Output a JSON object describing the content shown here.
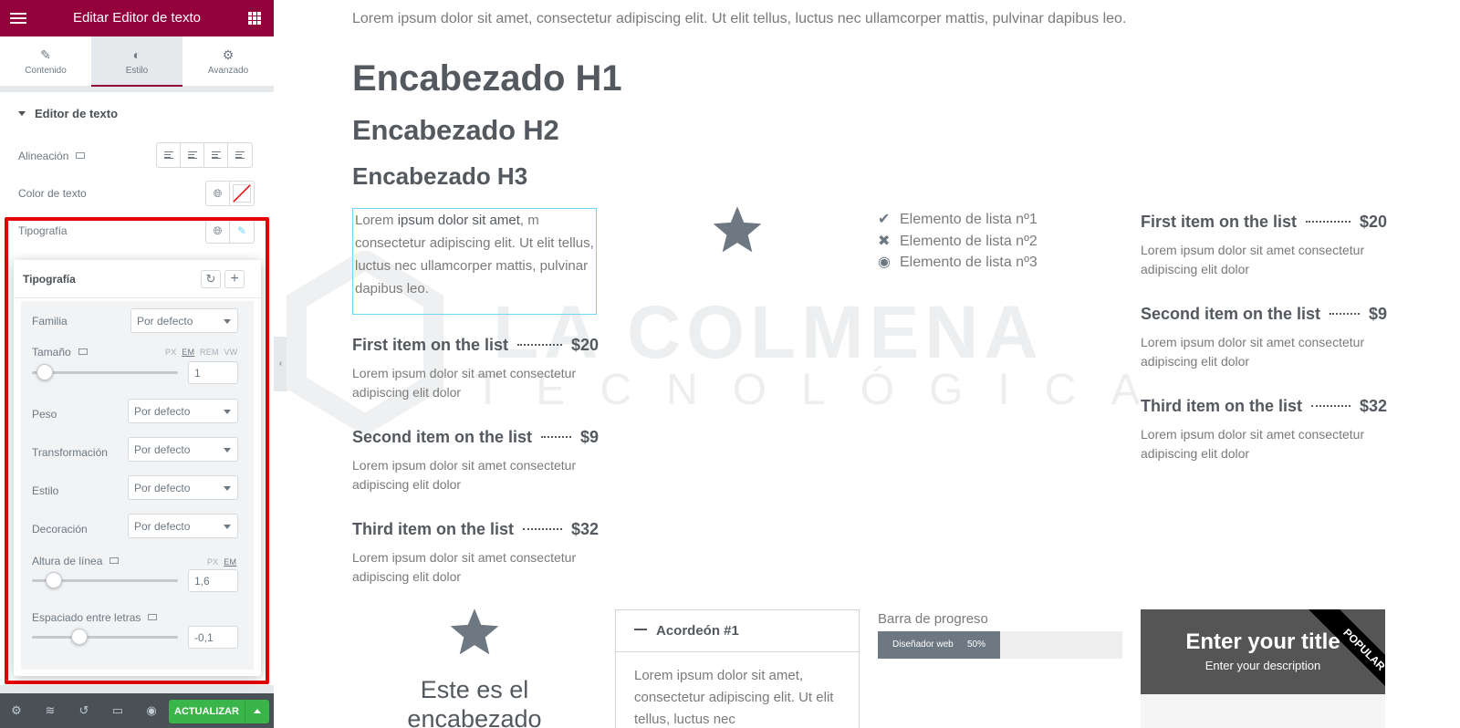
{
  "panel": {
    "title": "Editar Editor de texto",
    "tabs": [
      {
        "label": "Contenido",
        "icon": "pencil-icon"
      },
      {
        "label": "Estilo",
        "icon": "half-circle-icon"
      },
      {
        "label": "Avanzado",
        "icon": "gear-icon"
      }
    ],
    "section_title": "Editor de texto",
    "alignment_label": "Alineación",
    "text_color_label": "Color de texto",
    "typography_label": "Tipografía",
    "update_button": "ACTUALIZAR"
  },
  "typography_popup": {
    "title": "Tipografía",
    "family_label": "Familia",
    "family_value": "Por defecto",
    "size_label": "Tamaño",
    "size_units": [
      "PX",
      "EM",
      "REM",
      "VW"
    ],
    "size_active_unit": "EM",
    "size_value": "1",
    "weight_label": "Peso",
    "weight_value": "Por defecto",
    "transform_label": "Transformación",
    "transform_value": "Por defecto",
    "style_label": "Estilo",
    "style_value": "Por defecto",
    "decoration_label": "Decoración",
    "decoration_value": "Por defecto",
    "line_height_label": "Altura de línea",
    "line_height_units": [
      "PX",
      "EM"
    ],
    "line_height_value": "1,6",
    "letter_spacing_label": "Espaciado entre letras",
    "letter_spacing_value": "-0,1"
  },
  "canvas": {
    "intro": "Lorem ipsum dolor sit amet, consectetur adipiscing elit. Ut elit tellus, luctus nec ullamcorper mattis, pulvinar dapibus leo.",
    "h1": "Encabezado H1",
    "h2": "Encabezado H2",
    "h3": "Encabezado H3",
    "editing_text": {
      "before": "Lorem ",
      "strong": "ipsum dolor sit amet",
      "after": ", m consectetur adipiscing elit. Ut elit tellus, luctus nec ullamcorper mattis, pulvinar dapibus leo."
    },
    "icon_list": [
      {
        "icon": "check-icon",
        "text": "Elemento de lista nº1"
      },
      {
        "icon": "times-icon",
        "text": "Elemento de lista nº2"
      },
      {
        "icon": "dot-circle-icon",
        "text": "Elemento de lista nº3"
      }
    ],
    "price_list": [
      {
        "title": "First item on the list",
        "price": "$20",
        "desc": "Lorem ipsum dolor sit amet consectetur adipiscing elit dolor"
      },
      {
        "title": "Second item on the list",
        "price": "$9",
        "desc": "Lorem ipsum dolor sit amet consectetur adipiscing elit dolor"
      },
      {
        "title": "Third item on the list",
        "price": "$32",
        "desc": "Lorem ipsum dolor sit amet consectetur adipiscing elit dolor"
      }
    ],
    "icon_box_heading": "Este es el encabezado",
    "accordion": {
      "title": "Acordeón #1",
      "content": "Lorem ipsum dolor sit amet, consectetur adipiscing elit. Ut elit tellus, luctus nec"
    },
    "progress": {
      "label": "Barra de progreso",
      "inner_text": "Diseñador web",
      "percent_text": "50%",
      "value": 0.5
    },
    "price_table": {
      "title": "Enter your title",
      "description": "Enter your description",
      "ribbon": "POPULAR"
    },
    "watermark": {
      "line1": "LA COLMENA",
      "line2": "TECNOLÓGICA"
    }
  },
  "colors": {
    "brand": "#93003c",
    "update_green": "#39b54a",
    "highlight_red": "#e60000",
    "text_dark": "#54595f",
    "text_light": "#7a7a7a"
  }
}
